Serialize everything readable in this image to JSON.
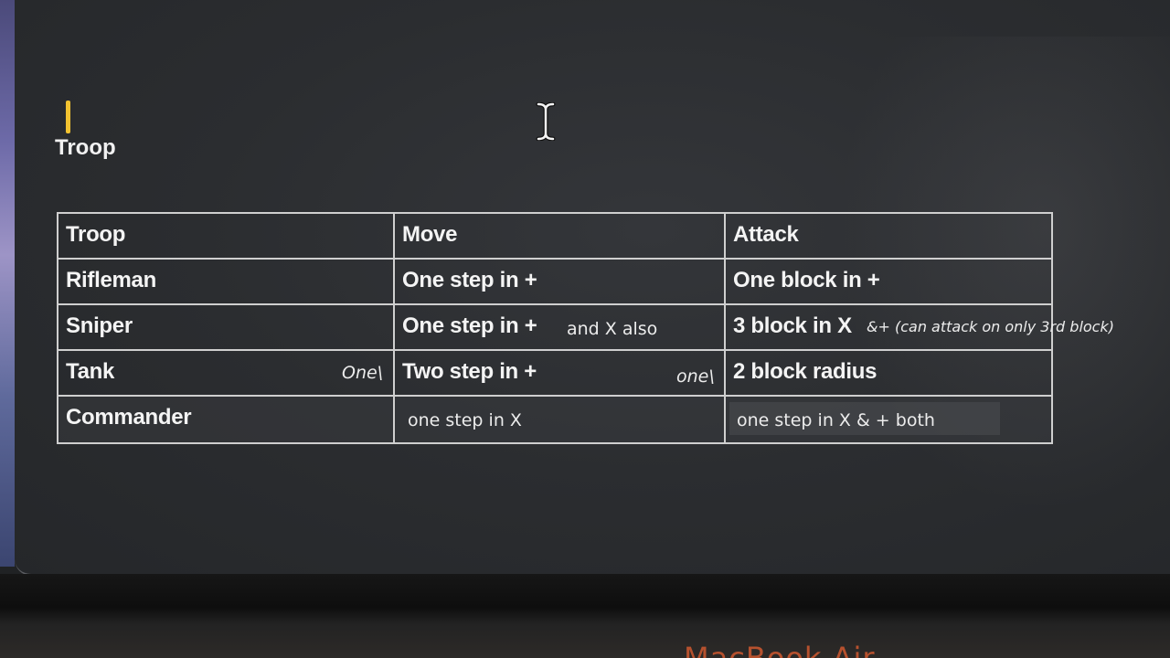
{
  "doc": {
    "top_cut_text": "",
    "heading": "Troop"
  },
  "table": {
    "headers": [
      "Troop",
      "Move",
      "Attack"
    ],
    "rows": [
      {
        "troop": "Rifleman",
        "troop_note": "",
        "move": "One step in +",
        "move_extra": "",
        "attack": "One block in +",
        "attack_extra": ""
      },
      {
        "troop": "Sniper",
        "troop_note": "",
        "move": "One step in +",
        "move_extra": "and X also",
        "attack": "3 block in X",
        "attack_extra": "&+ (can attack on only 3rd block)"
      },
      {
        "troop": "Tank",
        "troop_note": "One\\",
        "move": "Two step in +",
        "move_extra": "one\\",
        "attack": "2 block radius",
        "attack_extra": ""
      },
      {
        "troop": "Commander",
        "troop_note": "",
        "move": "one step in X",
        "move_extra": "",
        "attack": "one step in X & + both",
        "attack_extra": ""
      }
    ]
  },
  "bezel": {
    "brand": "MacBook Air"
  },
  "colors": {
    "cursor": "#f2c230",
    "text": "#f4f4f4",
    "grid": "#cfcfcf",
    "brand": "#b6512e"
  },
  "icons": {
    "text_cursor": "ibeam-cursor-icon"
  }
}
